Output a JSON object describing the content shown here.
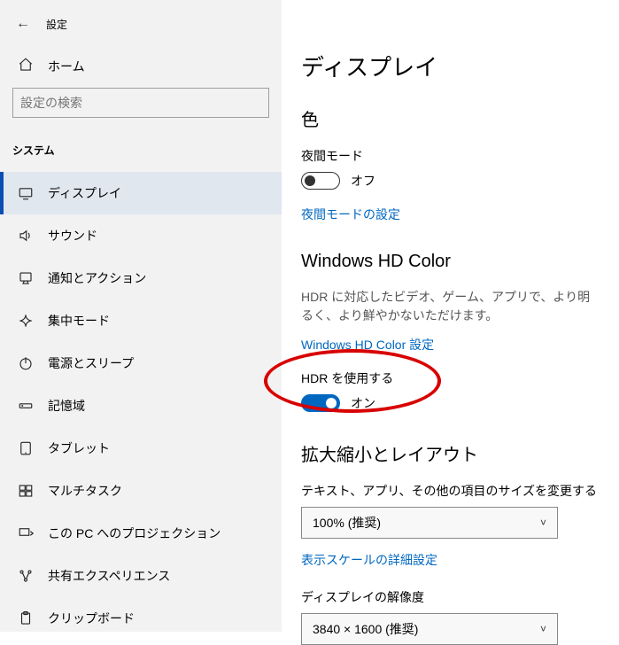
{
  "titlebar": {
    "title": "設定"
  },
  "nav": {
    "home_label": "ホーム",
    "search_placeholder": "設定の検索",
    "group_label": "システム",
    "items": [
      {
        "label": "ディスプレイ",
        "icon": "display",
        "selected": true
      },
      {
        "label": "サウンド",
        "icon": "sound",
        "selected": false
      },
      {
        "label": "通知とアクション",
        "icon": "notify",
        "selected": false
      },
      {
        "label": "集中モード",
        "icon": "focus",
        "selected": false
      },
      {
        "label": "電源とスリープ",
        "icon": "power",
        "selected": false
      },
      {
        "label": "記憶域",
        "icon": "storage",
        "selected": false
      },
      {
        "label": "タブレット",
        "icon": "tablet",
        "selected": false
      },
      {
        "label": "マルチタスク",
        "icon": "multitask",
        "selected": false
      },
      {
        "label": "この PC へのプロジェクション",
        "icon": "project",
        "selected": false
      },
      {
        "label": "共有エクスペリエンス",
        "icon": "share",
        "selected": false
      },
      {
        "label": "クリップボード",
        "icon": "clipboard",
        "selected": false
      }
    ]
  },
  "page": {
    "title": "ディスプレイ",
    "color": {
      "heading": "色",
      "night_label": "夜間モード",
      "night_state": "オフ",
      "night_link": "夜間モードの設定"
    },
    "hdcolor": {
      "heading": "Windows HD Color",
      "desc": "HDR に対応したビデオ、ゲーム、アプリで、より明るく、より鮮やかないただけます。",
      "link": "Windows HD Color 設定",
      "hdr_label": "HDR を使用する",
      "hdr_state": "オン"
    },
    "scale": {
      "heading": "拡大縮小とレイアウト",
      "text_size_label": "テキスト、アプリ、その他の項目のサイズを変更する",
      "text_size_value": "100% (推奨)",
      "link": "表示スケールの詳細設定",
      "res_label": "ディスプレイの解像度",
      "res_value": "3840 × 1600 (推奨)"
    }
  }
}
